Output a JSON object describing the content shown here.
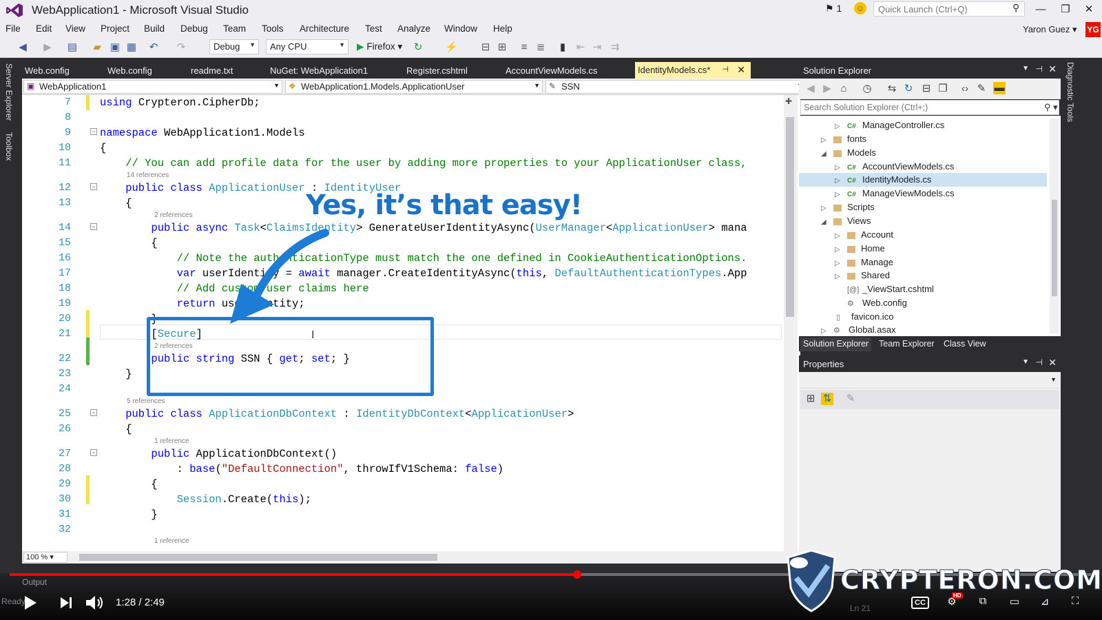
{
  "window": {
    "title": "WebApplication1 - Microsoft Visual Studio",
    "notifications": "1",
    "quick_launch_placeholder": "Quick Launch (Ctrl+Q)",
    "user_name": "Yaron Guez",
    "user_initials": "YG"
  },
  "menu": [
    "File",
    "Edit",
    "View",
    "Project",
    "Build",
    "Debug",
    "Team",
    "Tools",
    "Architecture",
    "Test",
    "Analyze",
    "Window",
    "Help"
  ],
  "toolbar": {
    "configuration": "Debug",
    "platform": "Any CPU",
    "run_target": "Firefox"
  },
  "side_tabs": {
    "left": [
      "Server Explorer",
      "Toolbox"
    ],
    "right": "Diagnostic Tools"
  },
  "tabs": [
    "Web.config",
    "Web.config",
    "readme.txt",
    "NuGet: WebApplication1",
    "Register.cshtml",
    "AccountViewModels.cs",
    "IdentityModels.cs*"
  ],
  "navbar": {
    "project": "WebApplication1",
    "type": "WebApplication1.Models.ApplicationUser",
    "member": "SSN"
  },
  "code": {
    "line_numbers": [
      "7",
      "8",
      "9",
      "10",
      "11",
      "12",
      "13",
      "14",
      "15",
      "16",
      "17",
      "18",
      "19",
      "20",
      "21",
      "22",
      "23",
      "24",
      "25",
      "26",
      "27",
      "28",
      "29",
      "30",
      "31",
      "32"
    ],
    "l7a": "using",
    "l7b": " Crypteron.CipherDb;",
    "l9a": "namespace",
    "l9b": " WebApplication1.Models",
    "l10": "{",
    "l11": "    // You can add profile data for the user by adding more properties to your ApplicationUser class,",
    "ref14": "14 references",
    "l12a": "    public class ",
    "l12b": "ApplicationUser",
    "l12c": " : ",
    "l12d": "IdentityUser",
    "l13": "    {",
    "ref2a": "2 references",
    "l14a": "        public async ",
    "l14b": "Task",
    "l14c": "<",
    "l14d": "ClaimsIdentity",
    "l14e": "> GenerateUserIdentityAsync(",
    "l14f": "UserManager",
    "l14g": "<",
    "l14h": "ApplicationUser",
    "l14i": "> mana",
    "l15": "        {",
    "l16": "            // Note the authenticationType must match the one defined in CookieAuthenticationOptions.",
    "l17a": "            var",
    "l17b": " userIdentity = ",
    "l17c": "await",
    "l17d": " manager.CreateIdentityAsync(",
    "l17e": "this",
    "l17f": ", ",
    "l17g": "DefaultAuthenticationTypes",
    "l17h": ".App",
    "l18": "            // Add custom user claims here",
    "l19a": "            return",
    "l19b": " userIdentity;",
    "l20": "        }",
    "l21a": "        [",
    "l21b": "Secure",
    "l21c": "]",
    "ref2b": "2 references",
    "l22a": "        public string",
    "l22b": " SSN { ",
    "l22c": "get",
    "l22d": "; ",
    "l22e": "set",
    "l22f": "; }",
    "l23": "    }",
    "ref5": "5 references",
    "l25a": "    public class ",
    "l25b": "ApplicationDbContext",
    "l25c": " : ",
    "l25d": "IdentityDbContext",
    "l25e": "<",
    "l25f": "ApplicationUser",
    "l25g": ">",
    "l26": "    {",
    "ref1a": "1 reference",
    "l27a": "        public",
    "l27b": " ApplicationDbContext()",
    "l28a": "            : ",
    "l28b": "base",
    "l28c": "(",
    "l28d": "\"DefaultConnection\"",
    "l28e": ", throwIfV1Schema: ",
    "l28f": "false",
    "l28g": ")",
    "l29": "        {",
    "l30a": "            ",
    "l30b": "Session",
    "l30c": ".Create(",
    "l30d": "this",
    "l30e": ");",
    "l31": "        }",
    "ref1b": "1 reference"
  },
  "annotation": {
    "callout": "Yes, it’s that easy!"
  },
  "editor": {
    "zoom": "100 %"
  },
  "solution_explorer": {
    "title": "Solution Explorer",
    "search_placeholder": "Search Solution Explorer (Ctrl+;)",
    "items": [
      {
        "label": "ManageController.cs",
        "kind": "cs"
      },
      {
        "label": "fonts",
        "kind": "folder"
      },
      {
        "label": "Models",
        "kind": "folder"
      },
      {
        "label": "AccountViewModels.cs",
        "kind": "cs"
      },
      {
        "label": "IdentityModels.cs",
        "kind": "cs"
      },
      {
        "label": "ManageViewModels.cs",
        "kind": "cs"
      },
      {
        "label": "Scripts",
        "kind": "folder"
      },
      {
        "label": "Views",
        "kind": "folder"
      },
      {
        "label": "Account",
        "kind": "folder"
      },
      {
        "label": "Home",
        "kind": "folder"
      },
      {
        "label": "Manage",
        "kind": "folder"
      },
      {
        "label": "Shared",
        "kind": "folder"
      },
      {
        "label": "_ViewStart.cshtml",
        "kind": "file"
      },
      {
        "label": "Web.config",
        "kind": "file"
      },
      {
        "label": "favicon.ico",
        "kind": "file"
      },
      {
        "label": "Global.asax",
        "kind": "file"
      }
    ],
    "bottom_tabs": [
      "Solution Explorer",
      "Team Explorer",
      "Class View"
    ]
  },
  "properties": {
    "title": "Properties"
  },
  "status": {
    "output": "Output",
    "ready": "Ready",
    "line": "Ln 21"
  },
  "video": {
    "time": "1:28 / 2:49",
    "progress": 0.524,
    "cc": "CC",
    "hd": "HD"
  },
  "watermark": {
    "text": "CRYPTERON.COM"
  },
  "colors": {
    "accent": "#1d7cd6",
    "progress": "#ff0000",
    "active_tab": "#fff1a8",
    "vs_purple": "#68217a"
  }
}
